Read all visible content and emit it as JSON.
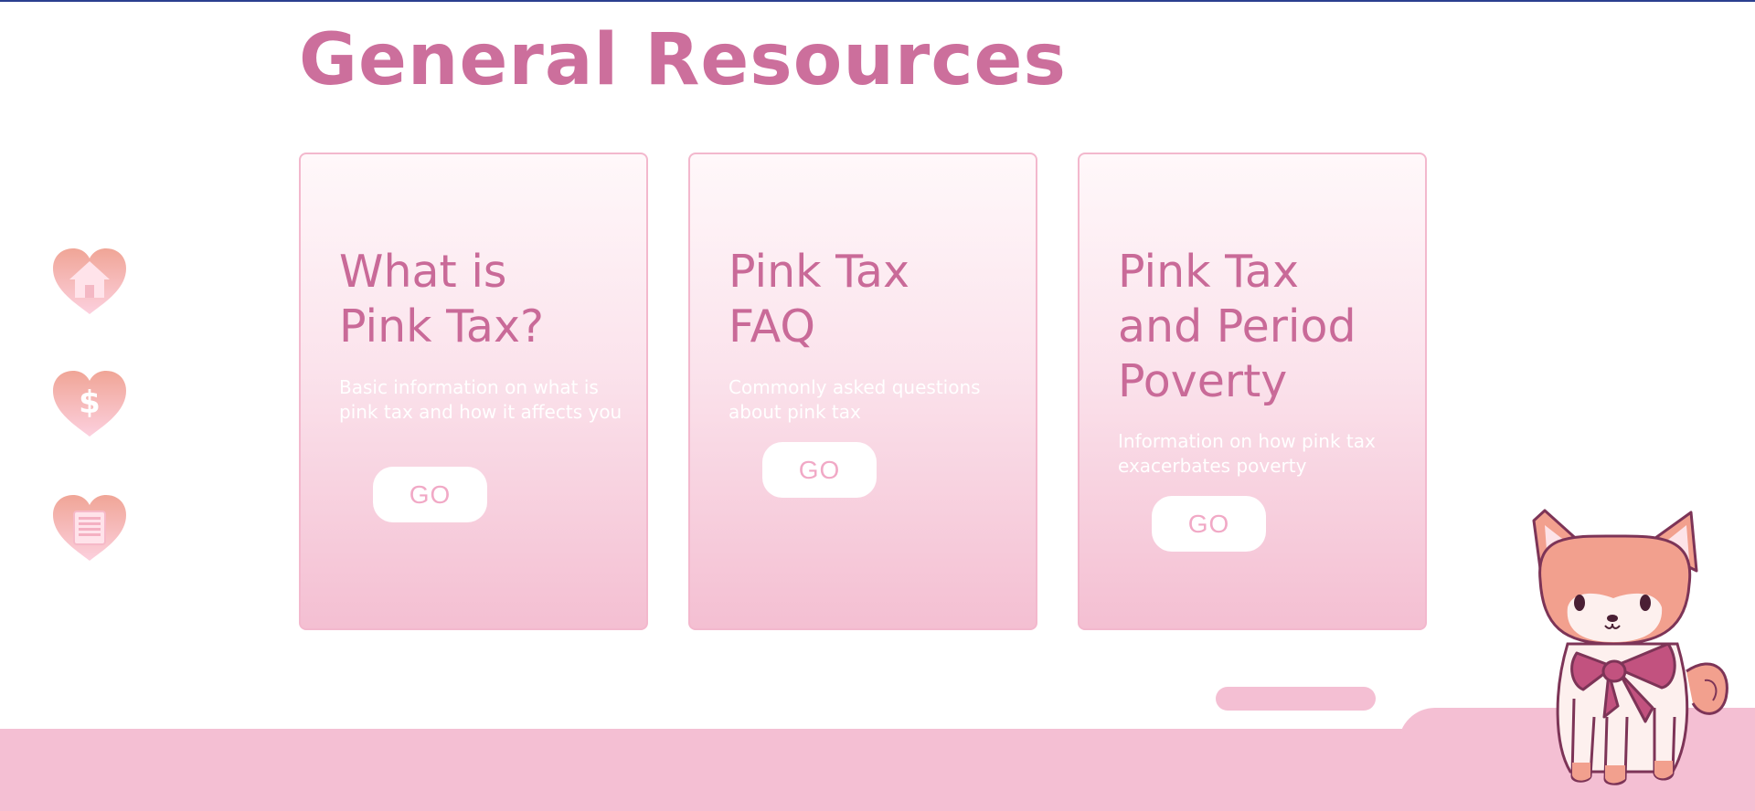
{
  "page": {
    "title": "General Resources"
  },
  "nav": [
    {
      "icon": "home-icon"
    },
    {
      "icon": "dollar-icon",
      "glyph": "$"
    },
    {
      "icon": "document-icon"
    }
  ],
  "cards": [
    {
      "title_lines": [
        "What is",
        "Pink Tax?"
      ],
      "description": "Basic information on what is pink tax and how it affects you",
      "button": "GO"
    },
    {
      "title_lines": [
        "Pink Tax",
        "FAQ"
      ],
      "description": "Commonly asked questions about pink tax",
      "button": "GO"
    },
    {
      "title_lines": [
        "Pink Tax",
        "and Period",
        "Poverty"
      ],
      "description": "Information on how pink tax exacerbates poverty",
      "button": "GO"
    }
  ],
  "colors": {
    "title": "#cc6f9c",
    "card_border": "#f3b8cd",
    "card_gradient_top": "#fff8fa",
    "card_gradient_bottom": "#f4bfd2",
    "heart_top": "#f0a596",
    "heart_bottom": "#fcd0de",
    "footer": "#f4bfd3",
    "accent_rule": "#2b3f8f"
  }
}
